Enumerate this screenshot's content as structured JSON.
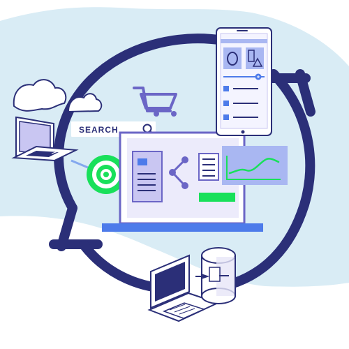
{
  "search": {
    "label": "SEARCH"
  },
  "colors": {
    "background": "#ffffff",
    "blob": "#d9ecf5",
    "navy": "#2b2f78",
    "purple": "#6b66c6",
    "lavender": "#c9c6f2",
    "card_blue": "#a9b7f2",
    "blue": "#4d7bea",
    "green": "#19e05a",
    "outline": "#ffffff"
  },
  "icons": [
    "cycle-arrows-icon",
    "cloud-laptop-icon",
    "shopping-cart-icon",
    "search-icon",
    "target-icon",
    "share-icon",
    "line-chart-icon",
    "tablet-icon",
    "laptop-icon",
    "database-icon"
  ]
}
